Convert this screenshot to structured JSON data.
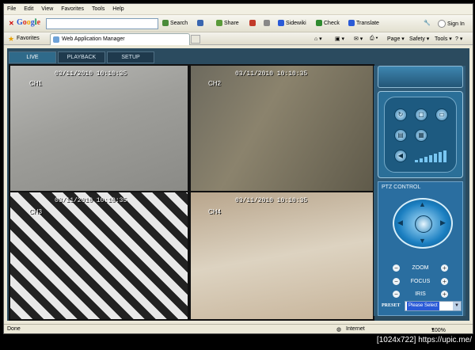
{
  "menu": [
    "File",
    "Edit",
    "View",
    "Favorites",
    "Tools",
    "Help"
  ],
  "toolbar": {
    "google": "Google",
    "search": "Search",
    "share": "Share",
    "sidewiki": "Sidewiki",
    "check": "Check",
    "translate": "Translate",
    "signin": "Sign In"
  },
  "favbar": {
    "favorites": "Favorites",
    "tab_title": "Web Application Manager",
    "page": "Page",
    "safety": "Safety",
    "tools": "Tools"
  },
  "app": {
    "tabs": [
      {
        "label": "LIVE",
        "active": true
      },
      {
        "label": "PLAYBACK",
        "active": false
      },
      {
        "label": "SETUP",
        "active": false
      }
    ],
    "cameras": [
      {
        "channel": "CH1",
        "timestamp": "03/11/2010 10:10:35"
      },
      {
        "channel": "CH2",
        "timestamp": "03/11/2010 10:10:35"
      },
      {
        "channel": "CH3",
        "timestamp": "03/11/2010 10:10:35"
      },
      {
        "channel": "CH4",
        "timestamp": "03/11/2010 10:10:35"
      }
    ],
    "ptz": {
      "title": "PTZ CONTROL",
      "zoom": "ZOOM",
      "focus": "FOCUS",
      "iris": "IRIS",
      "preset_label": "PRESET",
      "preset_value": "Please Select"
    }
  },
  "status": {
    "left": "Done",
    "zone": "Internet",
    "zoom": "100%"
  },
  "caption": "[1024x722] https://upic.me/",
  "colors": {
    "panel": "#2b4b5f",
    "accent": "#2a6ea0"
  }
}
